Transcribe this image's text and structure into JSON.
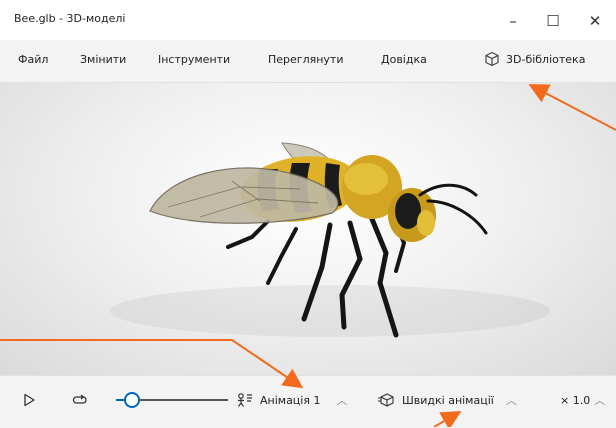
{
  "window": {
    "title": "Bee.glb - 3D-моделі"
  },
  "controls": {
    "minimize": "–",
    "maximize": "☐",
    "close": "✕"
  },
  "menu": {
    "items": [
      "Файл",
      "Змінити",
      "Інструменти",
      "Переглянути",
      "Довідка"
    ],
    "library_label": "3D-бібліотека"
  },
  "playback": {
    "animation_label": "Анімація 1",
    "quick_animations_label": "Швидкі анімації",
    "speed_label": "× 1.0"
  },
  "colors": {
    "accent": "#f26b1d",
    "slider": "#0067c0"
  }
}
